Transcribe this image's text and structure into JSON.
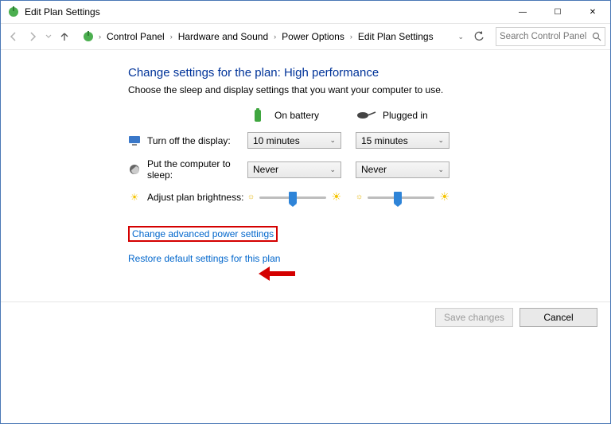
{
  "window": {
    "title": "Edit Plan Settings"
  },
  "breadcrumb": {
    "items": [
      "Control Panel",
      "Hardware and Sound",
      "Power Options",
      "Edit Plan Settings"
    ]
  },
  "search": {
    "placeholder": "Search Control Panel"
  },
  "heading": "Change settings for the plan: High performance",
  "subtext": "Choose the sleep and display settings that you want your computer to use.",
  "columns": {
    "battery": "On battery",
    "plugged": "Plugged in"
  },
  "rows": {
    "display": {
      "label": "Turn off the display:",
      "battery": "10 minutes",
      "plugged": "15 minutes"
    },
    "sleep": {
      "label": "Put the computer to sleep:",
      "battery": "Never",
      "plugged": "Never"
    },
    "brightness": {
      "label": "Adjust plan brightness:",
      "battery_pct": 50,
      "plugged_pct": 45
    }
  },
  "links": {
    "advanced": "Change advanced power settings",
    "restore": "Restore default settings for this plan"
  },
  "buttons": {
    "save": "Save changes",
    "cancel": "Cancel"
  }
}
